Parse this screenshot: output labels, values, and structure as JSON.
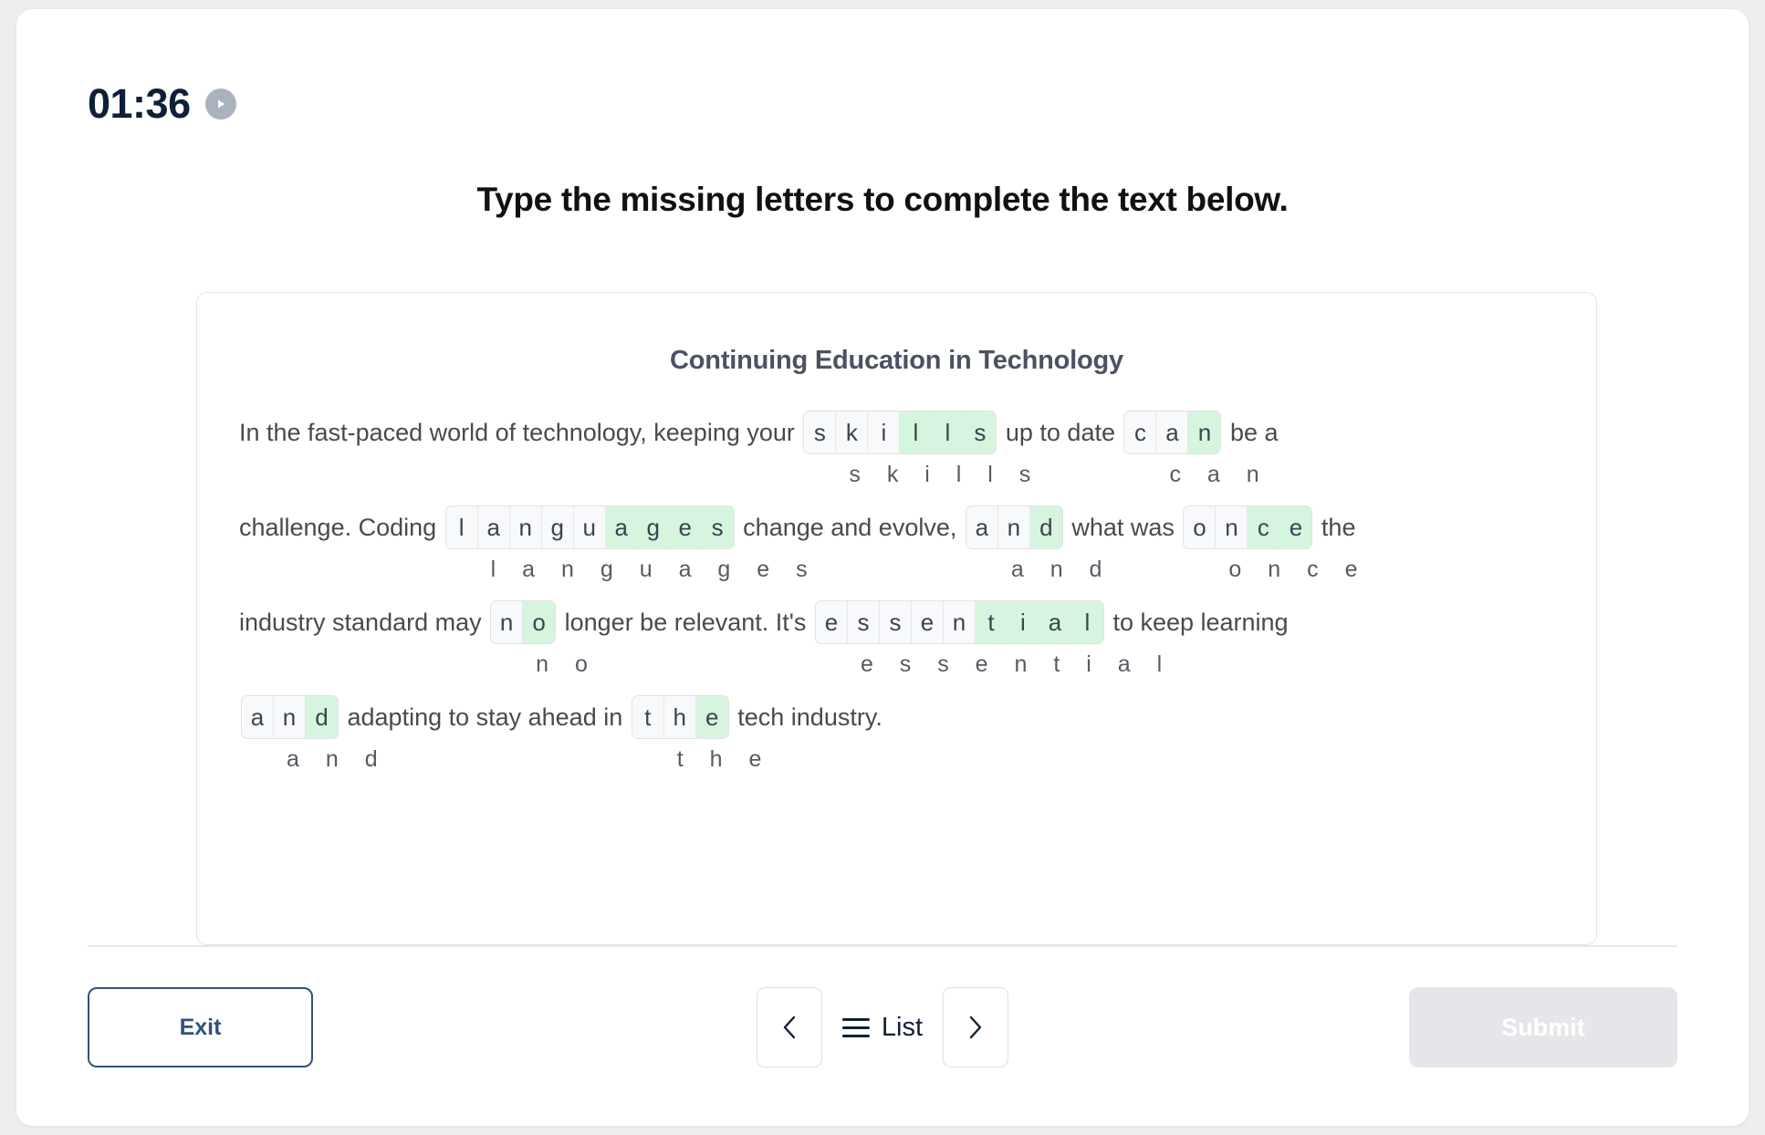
{
  "timer": {
    "value": "01:36",
    "play_icon": "play-icon"
  },
  "heading": "Type the missing letters to complete the text below.",
  "exercise": {
    "title": "Continuing Education in Technology",
    "lines": [
      {
        "segments": [
          {
            "type": "text",
            "text": "In the fast-paced world of technology, keeping your "
          },
          {
            "type": "word",
            "answer": "skills",
            "letters": [
              "s",
              "k",
              "i",
              "l",
              "l",
              "s"
            ],
            "filled": [
              false,
              false,
              false,
              true,
              true,
              true
            ]
          },
          {
            "type": "text",
            "text": " up to date "
          },
          {
            "type": "word",
            "answer": "can",
            "letters": [
              "c",
              "a",
              "n"
            ],
            "filled": [
              false,
              false,
              true
            ]
          },
          {
            "type": "text",
            "text": " be a"
          }
        ]
      },
      {
        "segments": [
          {
            "type": "text",
            "text": "challenge. Coding "
          },
          {
            "type": "word",
            "answer": "languages",
            "letters": [
              "l",
              "a",
              "n",
              "g",
              "u",
              "a",
              "g",
              "e",
              "s"
            ],
            "filled": [
              false,
              false,
              false,
              false,
              false,
              true,
              true,
              true,
              true
            ]
          },
          {
            "type": "text",
            "text": " change and evolve, "
          },
          {
            "type": "word",
            "answer": "and",
            "letters": [
              "a",
              "n",
              "d"
            ],
            "filled": [
              false,
              false,
              true
            ]
          },
          {
            "type": "text",
            "text": " what was "
          },
          {
            "type": "word",
            "answer": "once",
            "letters": [
              "o",
              "n",
              "c",
              "e"
            ],
            "filled": [
              false,
              false,
              true,
              true
            ]
          },
          {
            "type": "text",
            "text": " the"
          }
        ]
      },
      {
        "segments": [
          {
            "type": "text",
            "text": "industry standard may "
          },
          {
            "type": "word",
            "answer": "no",
            "letters": [
              "n",
              "o"
            ],
            "filled": [
              false,
              true
            ]
          },
          {
            "type": "text",
            "text": " longer be relevant. It's "
          },
          {
            "type": "word",
            "answer": "essential",
            "letters": [
              "e",
              "s",
              "s",
              "e",
              "n",
              "t",
              "i",
              "a",
              "l"
            ],
            "filled": [
              false,
              false,
              false,
              false,
              false,
              true,
              true,
              true,
              true
            ]
          },
          {
            "type": "text",
            "text": " to keep learning"
          }
        ]
      },
      {
        "segments": [
          {
            "type": "word",
            "answer": "and",
            "letters": [
              "a",
              "n",
              "d"
            ],
            "filled": [
              false,
              false,
              true
            ]
          },
          {
            "type": "text",
            "text": " adapting to stay ahead in "
          },
          {
            "type": "word",
            "answer": "the",
            "letters": [
              "t",
              "h",
              "e"
            ],
            "filled": [
              false,
              false,
              true
            ]
          },
          {
            "type": "text",
            "text": " tech industry."
          }
        ]
      }
    ]
  },
  "footer": {
    "exit_label": "Exit",
    "prev_icon": "chevron-left-icon",
    "list_label": "List",
    "list_icon": "hamburger-icon",
    "next_icon": "chevron-right-icon",
    "submit_label": "Submit"
  },
  "colors": {
    "page_background": "#eceef0",
    "timer_text": "#0e2038",
    "heading_text": "#111111",
    "passage_title": "#4a5263",
    "body_text": "#4a4a4a",
    "cell_empty": "#f8f9fb",
    "cell_filled": "#d6f5df",
    "exit_accent": "#31527f",
    "submit_disabled": "#e4e6e9"
  }
}
